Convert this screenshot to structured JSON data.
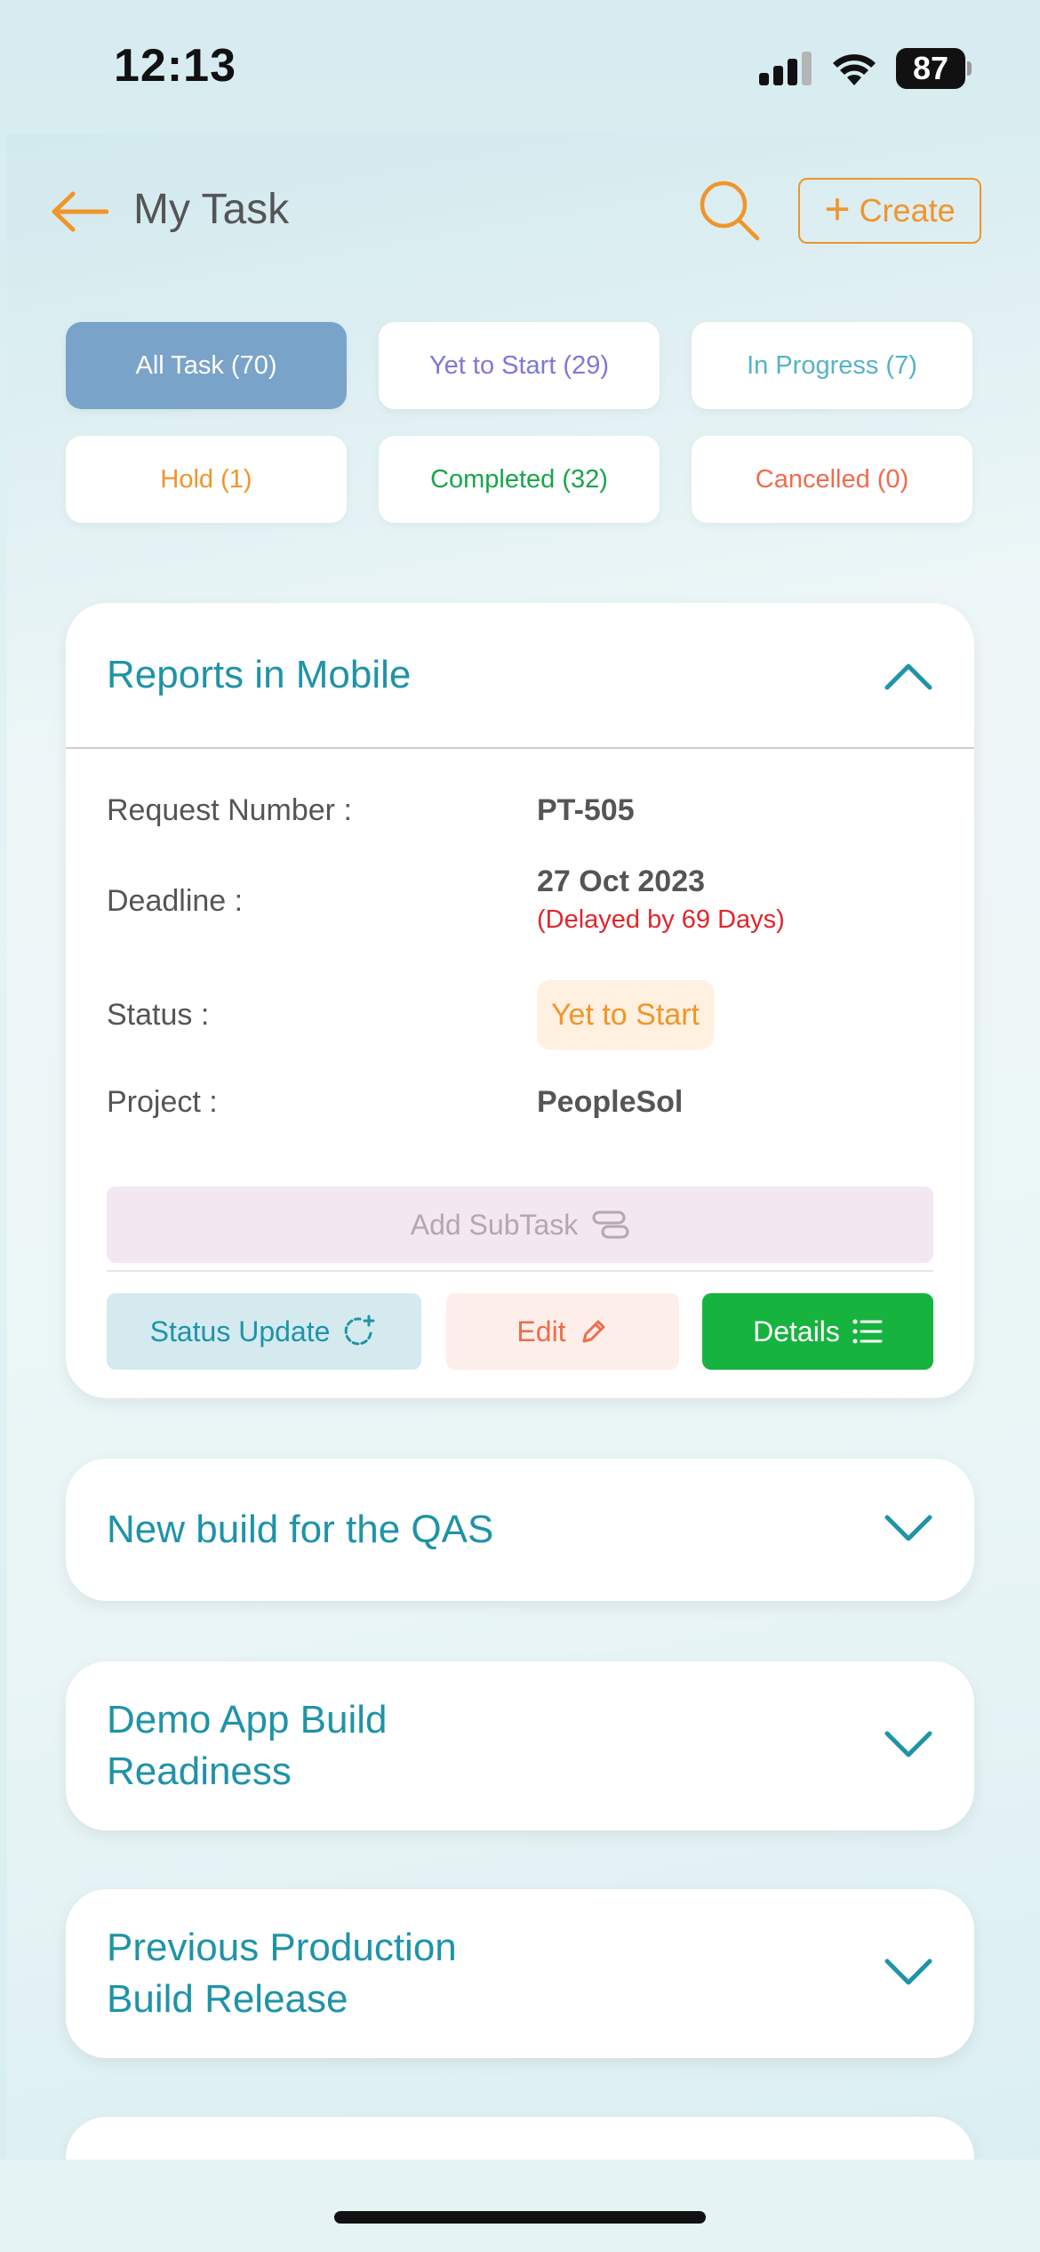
{
  "status_bar": {
    "time": "12:13",
    "battery": "87"
  },
  "header": {
    "title": "My Task",
    "create_label": "Create"
  },
  "filters": [
    {
      "label": "All Task (70)",
      "color": "#ffffff",
      "active": true
    },
    {
      "label": "Yet to Start (29)",
      "color": "#7f78d6"
    },
    {
      "label": "In Progress (7)",
      "color": "#54b3c7"
    },
    {
      "label": "Hold (1)",
      "color": "#f0952a"
    },
    {
      "label": "Completed (32)",
      "color": "#19a54a"
    },
    {
      "label": "Cancelled (0)",
      "color": "#f06b4d"
    }
  ],
  "tasks": [
    {
      "title": "Reports in Mobile",
      "expanded": true,
      "fields": {
        "request_number_label": "Request Number :",
        "request_number": "PT-505",
        "deadline_label": "Deadline :",
        "deadline": "27 Oct 2023",
        "delay": "(Delayed by 69 Days)",
        "status_label": "Status :",
        "status": "Yet to Start",
        "project_label": "Project :",
        "project": "PeopleSol"
      },
      "actions": {
        "add_subtask": "Add SubTask",
        "status_update": "Status Update",
        "edit": "Edit",
        "details": "Details"
      }
    },
    {
      "title": "New build for the QAS",
      "expanded": false
    },
    {
      "title": "Demo App Build Readiness",
      "expanded": false
    },
    {
      "title": "Previous Production Build Release",
      "expanded": false
    }
  ],
  "colors": {
    "accent": "#f0952a",
    "teal": "#1f93a8",
    "green": "#17b33f",
    "delay_red": "#e0262c"
  }
}
